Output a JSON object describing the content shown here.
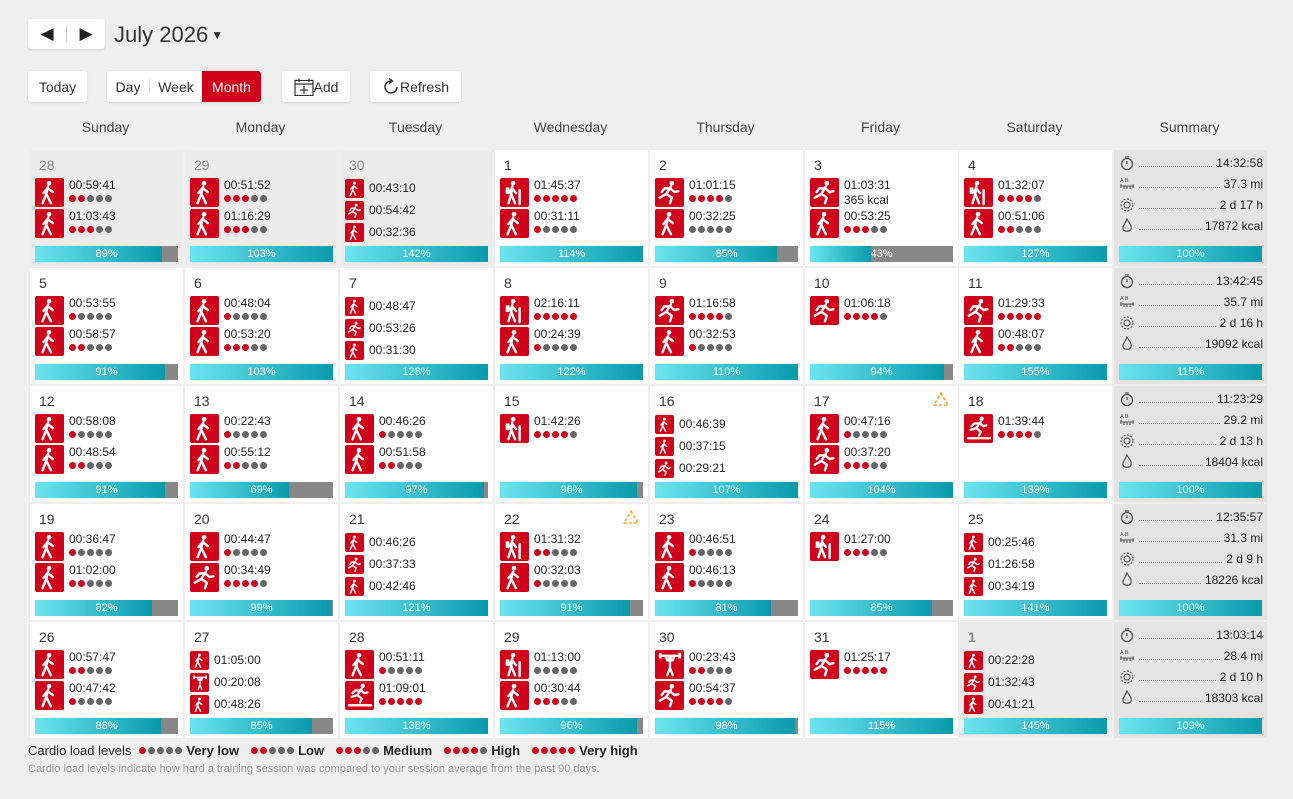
{
  "header": {
    "prev_arrow": "◀",
    "next_arrow": "▶",
    "month_title": "July 2026",
    "today_label": "Today",
    "views": [
      "Day",
      "Week",
      "Month"
    ],
    "active_view": "Month",
    "add_label": "Add",
    "refresh_label": "Refresh"
  },
  "weekdays": [
    "Sunday",
    "Monday",
    "Tuesday",
    "Wednesday",
    "Thursday",
    "Friday",
    "Saturday",
    "Summary"
  ],
  "colors": {
    "accent": "#d0021b",
    "bar_start": "#6de4f0",
    "bar_end": "#099aab",
    "bar_track": "#888888",
    "warning": "#f5a623"
  },
  "weeks": [
    {
      "days": [
        {
          "date": "28",
          "out": true,
          "sessions": [
            {
              "icon": "walk",
              "time": "00:59:41",
              "load": 2
            },
            {
              "icon": "walk",
              "time": "01:03:43",
              "load": 3
            }
          ],
          "pct": 89
        },
        {
          "date": "29",
          "out": true,
          "sessions": [
            {
              "icon": "walk",
              "time": "00:51:52",
              "load": 3
            },
            {
              "icon": "walk",
              "time": "01:16:29",
              "load": 3
            }
          ],
          "pct": 103
        },
        {
          "date": "30",
          "out": true,
          "sessions": [
            {
              "icon": "walk",
              "time": "00:43:10",
              "load": 0
            },
            {
              "icon": "run",
              "time": "00:54:42",
              "load": 0
            },
            {
              "icon": "walk",
              "time": "00:32:36",
              "load": 0
            }
          ],
          "pct": 142
        },
        {
          "date": "1",
          "sessions": [
            {
              "icon": "hike",
              "time": "01:45:37",
              "load": 5
            },
            {
              "icon": "walk",
              "time": "00:31:11",
              "load": 1
            }
          ],
          "pct": 114
        },
        {
          "date": "2",
          "sessions": [
            {
              "icon": "run",
              "time": "01:01:15",
              "load": 4
            },
            {
              "icon": "walk",
              "time": "00:32:25",
              "load": 0
            }
          ],
          "pct": 85
        },
        {
          "date": "3",
          "sessions": [
            {
              "icon": "run",
              "time": "01:03:31",
              "extra": "365 kcal",
              "load": null
            },
            {
              "icon": "walk",
              "time": "00:53:25",
              "load": 3
            }
          ],
          "pct": 43
        },
        {
          "date": "4",
          "sessions": [
            {
              "icon": "hike",
              "time": "01:32:07",
              "load": 4
            },
            {
              "icon": "walk",
              "time": "00:51:06",
              "load": 2
            }
          ],
          "pct": 127
        }
      ],
      "summary": {
        "duration": "14:32:58",
        "distance": "37.3 mi",
        "recovery": "2 d 17 h",
        "calories": "17872 kcal",
        "pct": 100
      }
    },
    {
      "days": [
        {
          "date": "5",
          "sessions": [
            {
              "icon": "walk",
              "time": "00:53:55",
              "load": 1
            },
            {
              "icon": "walk",
              "time": "00:58:57",
              "load": 2
            }
          ],
          "pct": 91
        },
        {
          "date": "6",
          "sessions": [
            {
              "icon": "walk",
              "time": "00:48:04",
              "load": 1
            },
            {
              "icon": "walk",
              "time": "00:53:20",
              "load": 3
            }
          ],
          "pct": 103
        },
        {
          "date": "7",
          "sessions": [
            {
              "icon": "walk",
              "time": "00:48:47",
              "load": 0
            },
            {
              "icon": "run",
              "time": "00:53:26",
              "load": 0
            },
            {
              "icon": "walk",
              "time": "00:31:30",
              "load": 0
            }
          ],
          "pct": 128
        },
        {
          "date": "8",
          "sessions": [
            {
              "icon": "hike",
              "time": "02:16:11",
              "load": 5
            },
            {
              "icon": "walk",
              "time": "00:24:39",
              "load": 1
            }
          ],
          "pct": 122
        },
        {
          "date": "9",
          "sessions": [
            {
              "icon": "run",
              "time": "01:16:58",
              "load": 4
            },
            {
              "icon": "walk",
              "time": "00:32:53",
              "load": 1
            }
          ],
          "pct": 110
        },
        {
          "date": "10",
          "sessions": [
            {
              "icon": "run",
              "time": "01:06:18",
              "load": 4
            }
          ],
          "pct": 94
        },
        {
          "date": "11",
          "sessions": [
            {
              "icon": "run",
              "time": "01:29:33",
              "load": 5
            },
            {
              "icon": "walk",
              "time": "00:48:07",
              "load": 2
            }
          ],
          "pct": 155
        }
      ],
      "summary": {
        "duration": "13:42:45",
        "distance": "35.7 mi",
        "recovery": "2 d 16 h",
        "calories": "19092 kcal",
        "pct": 115
      }
    },
    {
      "days": [
        {
          "date": "12",
          "sessions": [
            {
              "icon": "walk",
              "time": "00:58:08",
              "load": 1
            },
            {
              "icon": "walk",
              "time": "00:48:54",
              "load": 2
            }
          ],
          "pct": 91
        },
        {
          "date": "13",
          "sessions": [
            {
              "icon": "walk",
              "time": "00:22:43",
              "load": 1
            },
            {
              "icon": "walk",
              "time": "00:55:12",
              "load": 2
            }
          ],
          "pct": 69
        },
        {
          "date": "14",
          "sessions": [
            {
              "icon": "walk",
              "time": "00:46:26",
              "load": 1
            },
            {
              "icon": "walk",
              "time": "00:51:58",
              "load": 2
            }
          ],
          "pct": 97
        },
        {
          "date": "15",
          "sessions": [
            {
              "icon": "hike",
              "time": "01:42:26",
              "load": 4
            }
          ],
          "pct": 96
        },
        {
          "date": "16",
          "sessions": [
            {
              "icon": "walk",
              "time": "00:46:39",
              "load": 0
            },
            {
              "icon": "walk",
              "time": "00:37:15",
              "load": 0
            },
            {
              "icon": "run",
              "time": "00:29:21",
              "load": 0
            }
          ],
          "pct": 107
        },
        {
          "date": "17",
          "warning": true,
          "sessions": [
            {
              "icon": "walk",
              "time": "00:47:16",
              "load": 1
            },
            {
              "icon": "run",
              "time": "00:37:20",
              "load": 3
            }
          ],
          "pct": 104
        },
        {
          "date": "18",
          "sessions": [
            {
              "icon": "treadmill",
              "time": "01:39:44",
              "load": 4
            }
          ],
          "pct": 139
        }
      ],
      "summary": {
        "duration": "11:23:29",
        "distance": "29.2 mi",
        "recovery": "2 d 13 h",
        "calories": "18404 kcal",
        "pct": 100
      }
    },
    {
      "days": [
        {
          "date": "19",
          "sessions": [
            {
              "icon": "walk",
              "time": "00:36:47",
              "load": 1
            },
            {
              "icon": "walk",
              "time": "01:02:00",
              "load": 2
            }
          ],
          "pct": 82
        },
        {
          "date": "20",
          "sessions": [
            {
              "icon": "walk",
              "time": "00:44:47",
              "load": 1
            },
            {
              "icon": "run",
              "time": "00:34:49",
              "load": 4
            }
          ],
          "pct": 99
        },
        {
          "date": "21",
          "sessions": [
            {
              "icon": "walk",
              "time": "00:46:26",
              "load": 0
            },
            {
              "icon": "run",
              "time": "00:37:33",
              "load": 0
            },
            {
              "icon": "walk",
              "time": "00:42:46",
              "load": 0
            }
          ],
          "pct": 121
        },
        {
          "date": "22",
          "warning": true,
          "sessions": [
            {
              "icon": "hike",
              "time": "01:31:32",
              "load": 2
            },
            {
              "icon": "walk",
              "time": "00:32:03",
              "load": 1
            }
          ],
          "pct": 91
        },
        {
          "date": "23",
          "sessions": [
            {
              "icon": "walk",
              "time": "00:46:51",
              "load": 1
            },
            {
              "icon": "walk",
              "time": "00:46:13",
              "load": 1
            }
          ],
          "pct": 81
        },
        {
          "date": "24",
          "sessions": [
            {
              "icon": "hike",
              "time": "01:27:00",
              "load": 3
            }
          ],
          "pct": 85
        },
        {
          "date": "25",
          "sessions": [
            {
              "icon": "walk",
              "time": "00:25:46",
              "load": 0
            },
            {
              "icon": "run",
              "time": "01:26:58",
              "load": 0
            },
            {
              "icon": "walk",
              "time": "00:34:19",
              "load": 0
            }
          ],
          "pct": 141
        }
      ],
      "summary": {
        "duration": "12:35:57",
        "distance": "31.3 mi",
        "recovery": "2 d 9 h",
        "calories": "18226 kcal",
        "pct": 100
      }
    },
    {
      "days": [
        {
          "date": "26",
          "sessions": [
            {
              "icon": "walk",
              "time": "00:57:47",
              "load": 2
            },
            {
              "icon": "walk",
              "time": "00:47:42",
              "load": 1
            }
          ],
          "pct": 88
        },
        {
          "date": "27",
          "sessions": [
            {
              "icon": "walk",
              "time": "01:05:00",
              "load": 0
            },
            {
              "icon": "strength",
              "time": "00:20:08",
              "load": 0
            },
            {
              "icon": "walk",
              "time": "00:48:26",
              "load": 0
            }
          ],
          "pct": 85
        },
        {
          "date": "28",
          "sessions": [
            {
              "icon": "walk",
              "time": "00:51:11",
              "load": 1
            },
            {
              "icon": "treadmill",
              "time": "01:09:01",
              "load": 5
            }
          ],
          "pct": 138
        },
        {
          "date": "29",
          "sessions": [
            {
              "icon": "hike",
              "time": "01:13:00",
              "load": 0
            },
            {
              "icon": "walk",
              "time": "00:30:44",
              "load": 3
            }
          ],
          "pct": 96
        },
        {
          "date": "30",
          "sessions": [
            {
              "icon": "strength",
              "time": "00:23:43",
              "load": 2
            },
            {
              "icon": "run",
              "time": "00:54:37",
              "load": 4
            }
          ],
          "pct": 98
        },
        {
          "date": "31",
          "sessions": [
            {
              "icon": "run",
              "time": "01:25:17",
              "load": 5
            }
          ],
          "pct": 115
        },
        {
          "date": "1",
          "out": true,
          "today": true,
          "sessions": [
            {
              "icon": "walk",
              "time": "00:22:28",
              "load": 0
            },
            {
              "icon": "run",
              "time": "01:32:43",
              "load": 0
            },
            {
              "icon": "walk",
              "time": "00:41:21",
              "load": 0
            }
          ],
          "pct": 145
        }
      ],
      "summary": {
        "duration": "13:03:14",
        "distance": "28.4 mi",
        "recovery": "2 d 10 h",
        "calories": "18303 kcal",
        "pct": 109
      }
    }
  ],
  "legend": {
    "title": "Cardio load levels",
    "levels": [
      {
        "label": "Very low",
        "filled": 1
      },
      {
        "label": "Low",
        "filled": 2
      },
      {
        "label": "Medium",
        "filled": 3
      },
      {
        "label": "High",
        "filled": 4
      },
      {
        "label": "Very high",
        "filled": 5
      }
    ],
    "note": "Cardio load levels indicate how hard a training session was compared to your session average from the past 90 days."
  }
}
